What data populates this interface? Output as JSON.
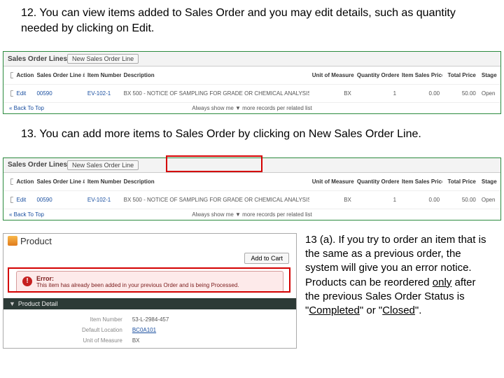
{
  "step12": {
    "text": "12. You can view items added to Sales Order and you may edit details, such as quantity needed by clicking on Edit."
  },
  "shot1": {
    "sectionTitle": "Sales Order Lines",
    "newBtn": "New Sales Order Line",
    "headers": {
      "action": "Action",
      "line": "Sales Order Line #",
      "item": "Item Number",
      "desc": "Description",
      "uom": "Unit of Measure",
      "qty": "Quantity Ordered",
      "price": "Item Sales Price",
      "total": "Total Price",
      "stage": "Stage"
    },
    "row": {
      "edit": "Edit",
      "line": "00590",
      "item": "EV-102-1",
      "desc": "BX 500 - NOTICE OF SAMPLING FOR GRADE OR CHEMICAL ANALYSIS",
      "uom": "BX",
      "qty": "1",
      "price": "0.00",
      "total": "50.00",
      "stage": "Open"
    },
    "backTop": "« Back To Top",
    "showMe": "Always show me ▼ more records per related list"
  },
  "step13": {
    "text": "13. You can add more items to Sales Order by clicking on New Sales Order Line."
  },
  "shot3": {
    "productTitle": "Product",
    "addCart": "Add to Cart",
    "errorTitle": "Error:",
    "errorMsg": "This item has already been added in your previous Order and is being Processed.",
    "detailTitle": "Product Detail",
    "fields": {
      "itemLbl": "Item Number",
      "itemVal": "53-L-2984-457",
      "locLbl": "Default Location",
      "locVal": "BC0A101",
      "uomLbl": "Unit of Measure",
      "uomVal": "BX"
    }
  },
  "step13a": {
    "prefix": "13 (a). If you try to order an item that is the same as a previous order, the system will give you an error notice.  Products can be reordered ",
    "only": "only",
    "middle": " after the previous Sales Order Status is \"",
    "completed": "Completed",
    "or": "\" or \"",
    "closed": "Closed",
    "suffix": "\"."
  }
}
